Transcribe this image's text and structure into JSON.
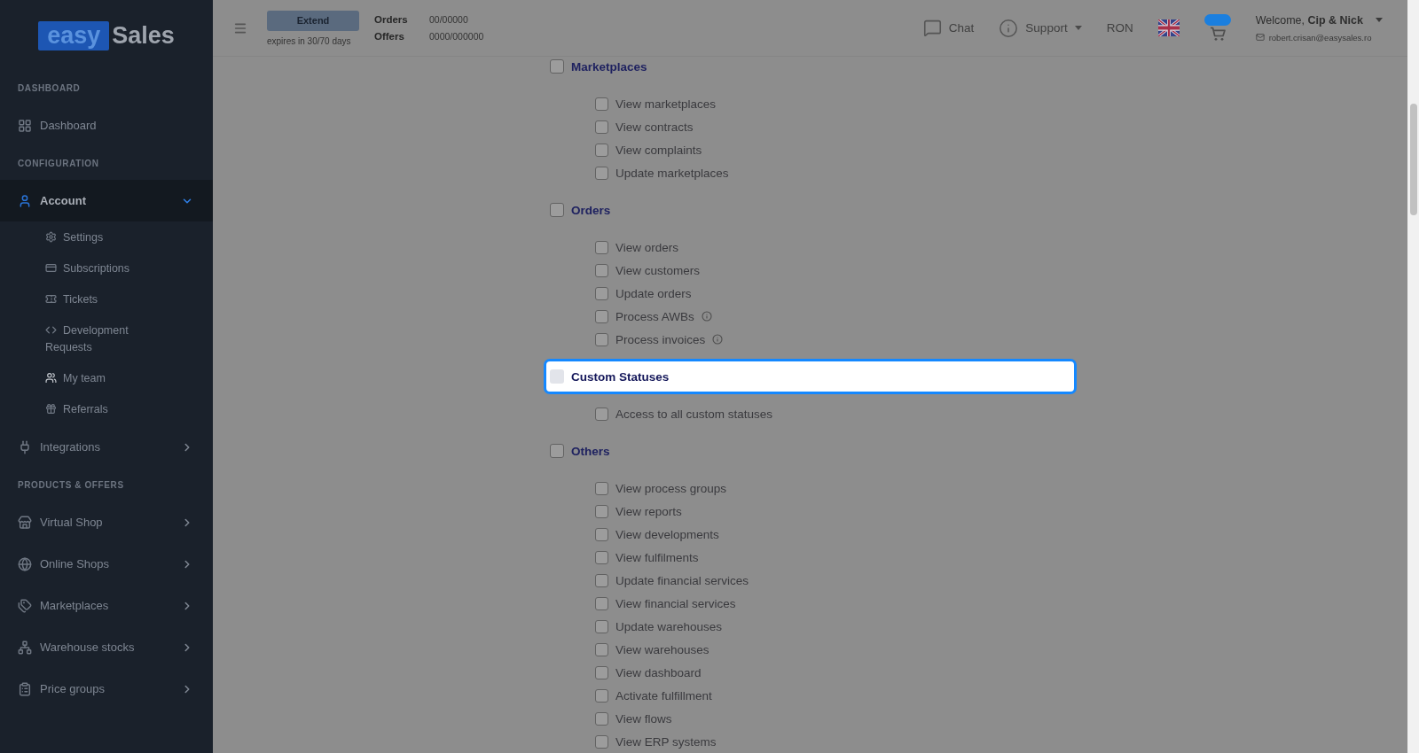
{
  "sidebar": {
    "logo": {
      "mark": "easy",
      "word": "Sales"
    },
    "sections": [
      {
        "title": "DASHBOARD",
        "items": [
          {
            "label": "Dashboard",
            "selected": false
          }
        ]
      },
      {
        "title": "CONFIGURATION",
        "items": [
          {
            "label": "Account",
            "selected": true,
            "expanded": true,
            "children": [
              {
                "label": "Settings"
              },
              {
                "label": "Subscriptions"
              },
              {
                "label": "Tickets"
              },
              {
                "label": "Development Requests"
              },
              {
                "label": "My team"
              },
              {
                "label": "Referrals"
              }
            ]
          },
          {
            "label": "Integrations",
            "selected": false,
            "expanded": false
          }
        ]
      },
      {
        "title": "PRODUCTS & OFFERS",
        "items": [
          {
            "label": "Virtual Shop",
            "selected": false,
            "expanded": false
          },
          {
            "label": "Online Shops",
            "selected": false,
            "expanded": false
          },
          {
            "label": "Marketplaces",
            "selected": false,
            "expanded": false
          },
          {
            "label": "Warehouse stocks",
            "selected": false,
            "expanded": false
          },
          {
            "label": "Price groups",
            "selected": false,
            "expanded": false
          }
        ]
      }
    ]
  },
  "header": {
    "plan": {
      "button": "Extend",
      "expiry": "expires in 30/70 days"
    },
    "usage": [
      {
        "label": "Orders",
        "value": "00/00000"
      },
      {
        "label": "Offers",
        "value": "0000/000000"
      }
    ],
    "chat": "Chat",
    "support": "Support",
    "currency": "RON",
    "welcome": "Welcome, **Cip & Nick**",
    "email": "robert.crisan@easysales.ro"
  },
  "permissions": {
    "groups": [
      {
        "title": "Marketplaces",
        "checked": false,
        "highlighted": false,
        "items": [
          {
            "label": "View marketplaces",
            "checked": false,
            "info": false
          },
          {
            "label": "View contracts",
            "checked": false,
            "info": false
          },
          {
            "label": "View complaints",
            "checked": false,
            "info": false
          },
          {
            "label": "Update marketplaces",
            "checked": false,
            "info": false
          }
        ]
      },
      {
        "title": "Orders",
        "checked": false,
        "highlighted": false,
        "items": [
          {
            "label": "View orders",
            "checked": false,
            "info": false
          },
          {
            "label": "View customers",
            "checked": false,
            "info": false
          },
          {
            "label": "Update orders",
            "checked": false,
            "info": false
          },
          {
            "label": "Process AWBs",
            "checked": false,
            "info": true
          },
          {
            "label": "Process invoices",
            "checked": false,
            "info": true
          }
        ]
      },
      {
        "title": "Custom Statuses",
        "checked": false,
        "highlighted": true,
        "items": [
          {
            "label": "Access to all custom statuses",
            "checked": false,
            "info": false
          }
        ]
      },
      {
        "title": "Others",
        "checked": false,
        "highlighted": false,
        "items": [
          {
            "label": "View process groups",
            "checked": false,
            "info": false
          },
          {
            "label": "View reports",
            "checked": false,
            "info": false
          },
          {
            "label": "View developments",
            "checked": false,
            "info": false
          },
          {
            "label": "View fulfilments",
            "checked": false,
            "info": false
          },
          {
            "label": "Update financial services",
            "checked": false,
            "info": false
          },
          {
            "label": "View financial services",
            "checked": false,
            "info": false
          },
          {
            "label": "Update warehouses",
            "checked": false,
            "info": false
          },
          {
            "label": "View warehouses",
            "checked": false,
            "info": false
          },
          {
            "label": "View dashboard",
            "checked": false,
            "info": false
          },
          {
            "label": "Activate fulfillment",
            "checked": false,
            "info": false
          },
          {
            "label": "View flows",
            "checked": false,
            "info": false
          },
          {
            "label": "View ERP systems",
            "checked": false,
            "info": false
          }
        ]
      }
    ]
  }
}
